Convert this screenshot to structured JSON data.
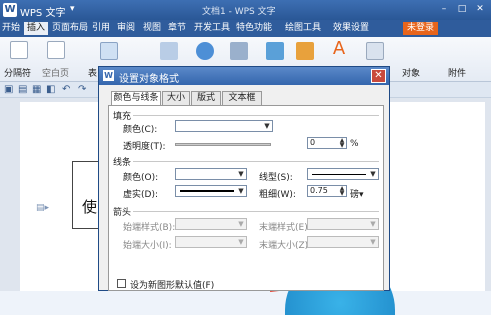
{
  "titlebar": {
    "logo": "W",
    "app_name": "WPS 文字",
    "app_chevron": "▾",
    "doc_title": "文档1 - WPS 文字",
    "btn_min": "–",
    "btn_max": "□",
    "btn_close": "✕"
  },
  "menu": [
    "开始",
    "插入",
    "页面布局",
    "引用",
    "审阅",
    "视图",
    "章节",
    "开发工具",
    "特色功能",
    "绘图工具",
    "效果设置"
  ],
  "menu_login": "未登录",
  "ribbon": {
    "paginator": "分隔符",
    "blank_page": "空白页",
    "table_cut": "表",
    "object": "对象",
    "attachment": "附件"
  },
  "dialog": {
    "icon": "W",
    "title": "设置对象格式",
    "close": "✕",
    "tabs": [
      "颜色与线条",
      "大小",
      "版式",
      "文本框"
    ],
    "fill": {
      "section": "填充",
      "color_label": "颜色(C):",
      "transparency_label": "透明度(T):",
      "transparency_value": "0",
      "transparency_unit": "%"
    },
    "line": {
      "section": "线条",
      "color_label": "颜色(O):",
      "style_label": "线型(S):",
      "dash_label": "虚实(D):",
      "weight_label": "粗细(W):",
      "weight_value": "0.75",
      "weight_unit": "磅▾"
    },
    "arrows": {
      "section": "箭头",
      "begin_style": "始端样式(B):",
      "end_style": "末端样式(E):",
      "begin_size": "始端大小(I):",
      "end_size": "末端大小(Z):"
    },
    "default_checkbox": "设为新图形默认值(F)"
  },
  "document": {
    "textbox_text": "使买"
  }
}
